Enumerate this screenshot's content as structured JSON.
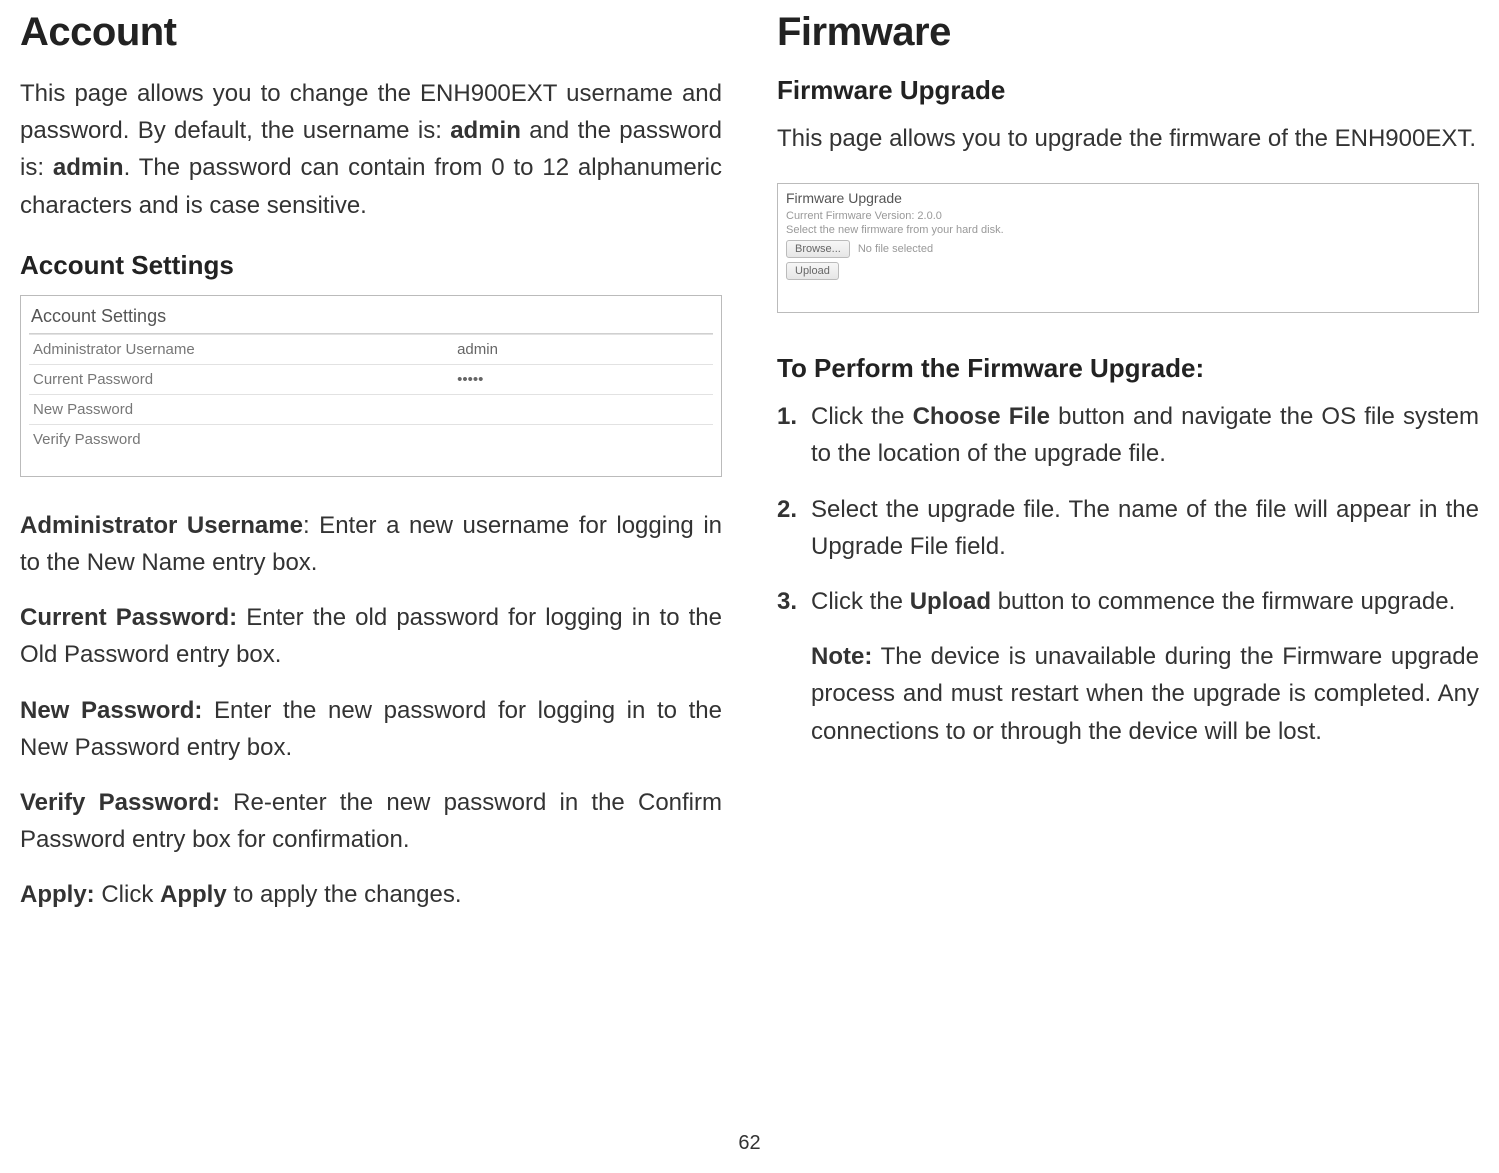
{
  "page_number": "62",
  "left": {
    "heading": "Account",
    "intro_parts": [
      "This page allows you to change the ENH900EXT username and password. By default, the username is: ",
      "admin",
      " and the password is: ",
      "admin",
      ". The password can contain from 0 to 12 alphanumeric characters and is case sensitive."
    ],
    "settings_heading": "Account Settings",
    "panel_title": "Account Settings",
    "rows": [
      {
        "label": "Administrator Username",
        "value": "admin"
      },
      {
        "label": "Current Password",
        "value": "•••••"
      },
      {
        "label": "New Password",
        "value": ""
      },
      {
        "label": "Verify Password",
        "value": ""
      }
    ],
    "defs": [
      {
        "label": "Administrator Username",
        "text": ": Enter a new username for logging in to the New Name entry box."
      },
      {
        "label": "Current Password:",
        "text": " Enter the old password for logging in to the Old Password entry box."
      },
      {
        "label": "New Password:",
        "text": " Enter the new password for logging in to the New Password entry box."
      },
      {
        "label": "Verify Password:",
        "text": " Re-enter the new password in the Confirm Password entry box for confirmation."
      },
      {
        "label": "Apply:",
        "text_pre": " Click ",
        "text_bold": "Apply",
        "text_post": " to apply the changes."
      }
    ]
  },
  "right": {
    "heading": "Firmware",
    "sub_heading": "Firmware Upgrade",
    "intro": "This page allows you to upgrade the firmware of the ENH900EXT.",
    "panel": {
      "title": "Firmware Upgrade",
      "version_line": "Current Firmware Version: 2.0.0",
      "select_line": "Select the new firmware from your hard disk.",
      "browse_label": "Browse...",
      "no_file": "No file selected",
      "upload_label": "Upload"
    },
    "steps_heading": "To Perform the Firmware Upgrade:",
    "steps": [
      {
        "num": "1.",
        "parts": [
          "Click the ",
          "Choose File",
          " button and navigate the OS file system to the location of the upgrade file."
        ]
      },
      {
        "num": "2.",
        "text": "Select the upgrade file. The name of the file will appear in the Upgrade File field."
      },
      {
        "num": "3.",
        "parts": [
          "Click the ",
          "Upload",
          " button to commence the firmware upgrade."
        ]
      }
    ],
    "note": {
      "label": "Note:",
      "text": " The device is unavailable during the Firmware upgrade process and must restart when the upgrade is completed. Any connections to or through the device will be lost."
    }
  }
}
